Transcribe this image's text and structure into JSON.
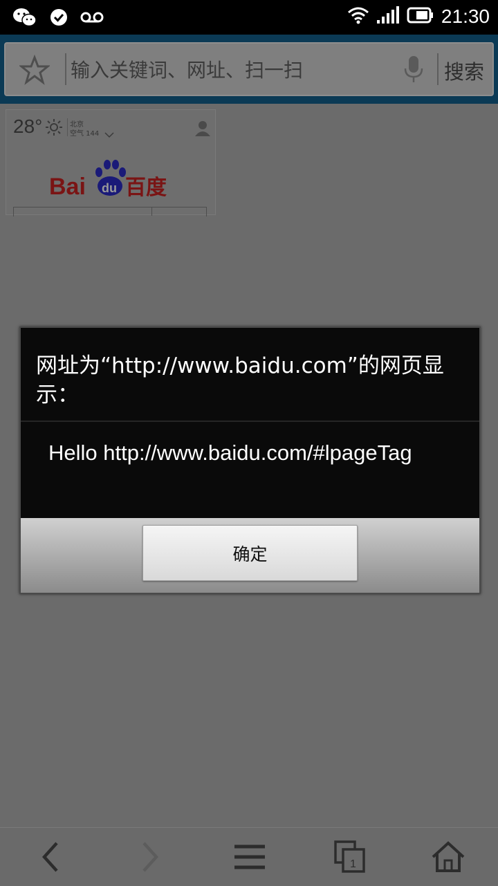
{
  "status_bar": {
    "time": "21:30",
    "icons": [
      "wechat-icon",
      "check-icon",
      "voicemail-icon",
      "wifi-icon",
      "signal-icon",
      "battery-icon"
    ]
  },
  "browser": {
    "search_placeholder": "输入关键词、网址、扫一扫",
    "search_button": "搜索"
  },
  "page": {
    "weather": {
      "temperature": "28°",
      "city": "北京",
      "air_quality": "空气 144"
    },
    "logo_text": "Bai百度",
    "logo_paw_text": "du"
  },
  "dialog": {
    "title": "网址为“http://www.baidu.com”的网页显示：",
    "message": "Hello http://www.baidu.com/#lpageTag",
    "ok_button": "确定"
  },
  "nav": {
    "tab_count": "1",
    "icons": [
      "back-icon",
      "forward-icon",
      "menu-icon",
      "tabs-icon",
      "home-icon"
    ]
  }
}
